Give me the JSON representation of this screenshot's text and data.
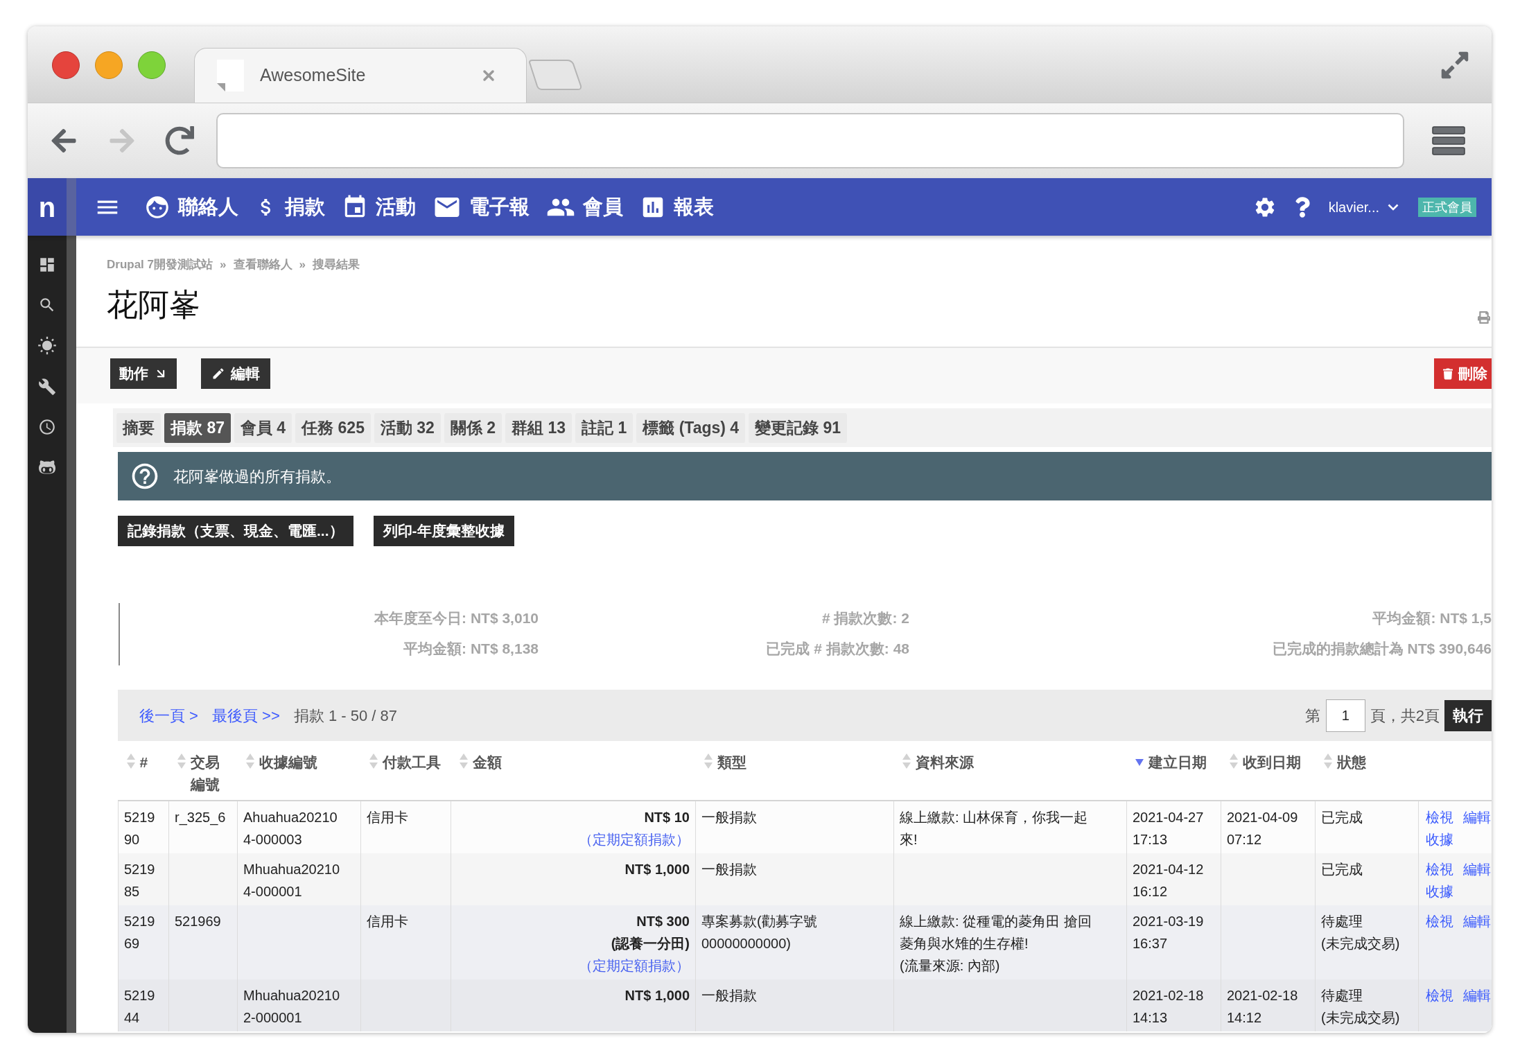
{
  "browser": {
    "tab_title": "AwesomeSite",
    "nav_buttons": [
      {
        "kind": "back",
        "disabled": false
      },
      {
        "kind": "forward",
        "disabled": true
      },
      {
        "kind": "reload",
        "disabled": false
      }
    ]
  },
  "navbar": {
    "logo": "n",
    "menu": [
      {
        "kind": "contacts",
        "label": "聯絡人"
      },
      {
        "kind": "contributions",
        "label": "捐款"
      },
      {
        "kind": "events",
        "label": "活動"
      },
      {
        "kind": "mailings",
        "label": "電子報"
      },
      {
        "kind": "members",
        "label": "會員"
      },
      {
        "kind": "reports",
        "label": "報表"
      }
    ],
    "user": "klavier...",
    "badge": "正式會員"
  },
  "page": {
    "breadcrumb": [
      {
        "label": "Drupal 7開發測試站",
        "separator": "»"
      },
      {
        "label": "查看聯絡人",
        "separator": "»"
      },
      {
        "label": "搜尋結果"
      }
    ],
    "title": "花阿峯"
  },
  "actions": [
    {
      "kind": "menu",
      "label": "動作"
    },
    {
      "kind": "edit",
      "label": "編輯"
    },
    {
      "kind": "delete",
      "label": "刪除"
    }
  ],
  "tabs": [
    {
      "label": "摘要",
      "selected": false
    },
    {
      "label": "捐款 87",
      "selected": true
    },
    {
      "label": "會員 4",
      "selected": false
    },
    {
      "label": "任務 625",
      "selected": false
    },
    {
      "label": "活動 32",
      "selected": false
    },
    {
      "label": "關係 2",
      "selected": false
    },
    {
      "label": "群組 13",
      "selected": false
    },
    {
      "label": "註記 1",
      "selected": false
    },
    {
      "label": "標籤 (Tags) 4",
      "selected": false
    },
    {
      "label": "變更記錄 91",
      "selected": false
    }
  ],
  "info": "花阿峯做過的所有捐款。",
  "buttons": [
    "記錄捐款（支票、現金、電匯...）",
    "列印-年度彙整收據"
  ],
  "stats": [
    {
      "lines": [
        "本年度至今日: NT$ 3,010",
        "平均金額: NT$ 8,138"
      ]
    },
    {
      "lines": [
        "# 捐款次數: 2",
        "已完成 # 捐款次數: 48"
      ]
    },
    {
      "lines": [
        "平均金額: NT$ 1,5",
        "已完成的捐款總計為 NT$ 390,646"
      ]
    }
  ],
  "pager": {
    "links": [
      "後一頁 >",
      "最後頁 >>"
    ],
    "summary": "捐款 1 - 50 / 87",
    "page_label": "第",
    "page": "1",
    "page_total": "頁，共2頁",
    "go": "執行"
  },
  "table": {
    "columns": [
      {
        "label": "#",
        "sorted": false
      },
      {
        "label": "交易編號",
        "sorted": false
      },
      {
        "label": "收據編號",
        "sorted": false
      },
      {
        "label": "付款工具",
        "sorted": false
      },
      {
        "label": "金額",
        "sorted": false
      },
      {
        "label": "類型",
        "sorted": false
      },
      {
        "label": "資料來源",
        "sorted": false
      },
      {
        "label": "建立日期",
        "sorted": true
      },
      {
        "label": "收到日期",
        "sorted": false
      },
      {
        "label": "狀態",
        "sorted": false
      }
    ],
    "rows": [
      {
        "id": "521990",
        "transaction": "r_325_6",
        "receipt": "Ahuahua202104-000003",
        "instrument": "信用卡",
        "amount": "NT$ 10",
        "recurring": "（定期定額捐款）",
        "type": "一般捐款",
        "source": "線上繳款: 山林保育，你我一起來!",
        "created": "2021-04-27 17:13",
        "received": "2021-04-09 07:12",
        "status": "已完成",
        "pending": false,
        "links": [
          "檢視",
          "編輯",
          "收據"
        ]
      },
      {
        "id": "521985",
        "receipt": "Mhuahua202104-000001",
        "amount": "NT$ 1,000",
        "type": "一般捐款",
        "created": "2021-04-12 16:12",
        "status": "已完成",
        "pending": false,
        "links": [
          "檢視",
          "編輯",
          "收據"
        ]
      },
      {
        "id": "521969",
        "transaction": "521969",
        "instrument": "信用卡",
        "amount": "NT$ 300",
        "amount_note": "(認養一分田)",
        "recurring": "（定期定額捐款）",
        "type": "專案募款(勸募字號00000000000)",
        "source": "線上繳款: 從種電的菱角田 搶回菱角與水雉的生存權!",
        "source_note": "(流量來源: 內部)",
        "created": "2021-03-19 16:37",
        "status": "待處理",
        "status_note": "(未完成交易)",
        "pending": true,
        "links": [
          "檢視",
          "編輯"
        ]
      },
      {
        "id": "521944",
        "receipt": "Mhuahua202102-000001",
        "amount": "NT$ 1,000",
        "type": "一般捐款",
        "created": "2021-02-18 14:13",
        "received": "2021-02-18 14:12",
        "status": "待處理",
        "status_note": "(未完成交易)",
        "pending": true,
        "links": [
          "檢視",
          "編輯"
        ]
      }
    ]
  }
}
